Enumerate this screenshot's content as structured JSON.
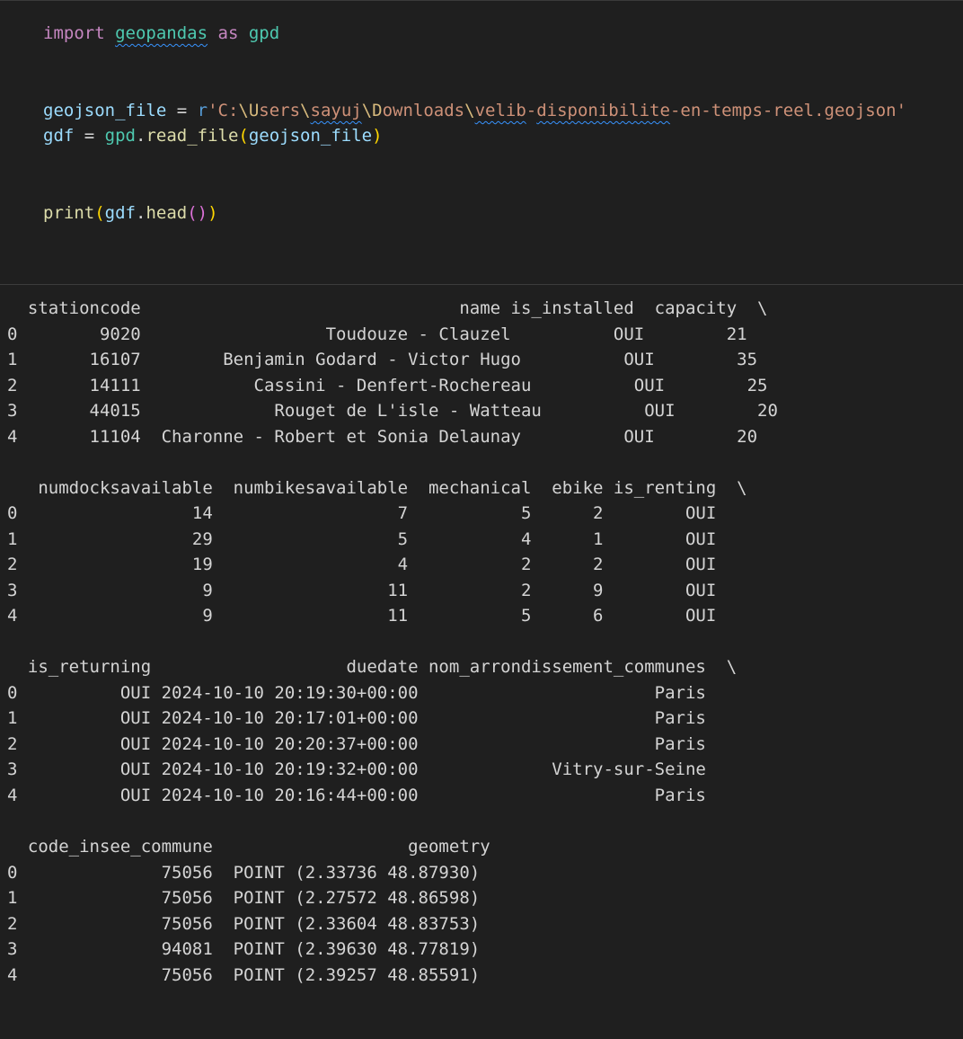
{
  "code": {
    "line1": {
      "kw_import": "import",
      "module": "geopandas",
      "kw_as": "as",
      "alias": "gpd"
    },
    "line2": {
      "var": "geojson_file",
      "eq": " = ",
      "prefix": "r",
      "str_a": "'C:",
      "esc_users": "\\U",
      "str_b": "sers",
      "sep1": "\\",
      "user": "sayuj",
      "esc_downloads": "\\D",
      "str_c": "ownloads",
      "esc_velib": "\\",
      "fname_a": "velib",
      "fname_dash1": "-",
      "fname_b": "disponibilite",
      "fname_rest": "-en-temps-reel.geojson'"
    },
    "line3": {
      "var": "gdf",
      "eq": " = ",
      "mod": "gpd",
      "dot": ".",
      "fn": "read_file",
      "open": "(",
      "arg": "geojson_file",
      "close": ")"
    },
    "line4": {
      "fn": "print",
      "open": "(",
      "obj": "gdf",
      "dot": ".",
      "method": "head",
      "inner": "()",
      "close": ")"
    }
  },
  "output": {
    "lines": [
      "  stationcode                               name is_installed  capacity  \\",
      "0        9020                  Toudouze - Clauzel          OUI        21   ",
      "1       16107        Benjamin Godard - Victor Hugo          OUI        35   ",
      "2       14111           Cassini - Denfert-Rochereau          OUI        25   ",
      "3       44015             Rouget de L'isle - Watteau          OUI        20   ",
      "4       11104  Charonne - Robert et Sonia Delaunay          OUI        20   ",
      "",
      "   numdocksavailable  numbikesavailable  mechanical  ebike is_renting  \\",
      "0                 14                  7           5      2        OUI   ",
      "1                 29                  5           4      1        OUI   ",
      "2                 19                  4           2      2        OUI   ",
      "3                  9                 11           2      9        OUI   ",
      "4                  9                 11           5      6        OUI   ",
      "",
      "  is_returning                   duedate nom_arrondissement_communes  \\",
      "0          OUI 2024-10-10 20:19:30+00:00                       Paris   ",
      "1          OUI 2024-10-10 20:17:01+00:00                       Paris   ",
      "2          OUI 2024-10-10 20:20:37+00:00                       Paris   ",
      "3          OUI 2024-10-10 20:19:32+00:00             Vitry-sur-Seine   ",
      "4          OUI 2024-10-10 20:16:44+00:00                       Paris   ",
      "",
      "  code_insee_commune                   geometry  ",
      "0              75056  POINT (2.33736 48.87930)  ",
      "1              75056  POINT (2.27572 48.86598)  ",
      "2              75056  POINT (2.33604 48.83753)  ",
      "3              94081  POINT (2.39630 48.77819)  ",
      "4              75056  POINT (2.39257 48.85591)  "
    ]
  }
}
